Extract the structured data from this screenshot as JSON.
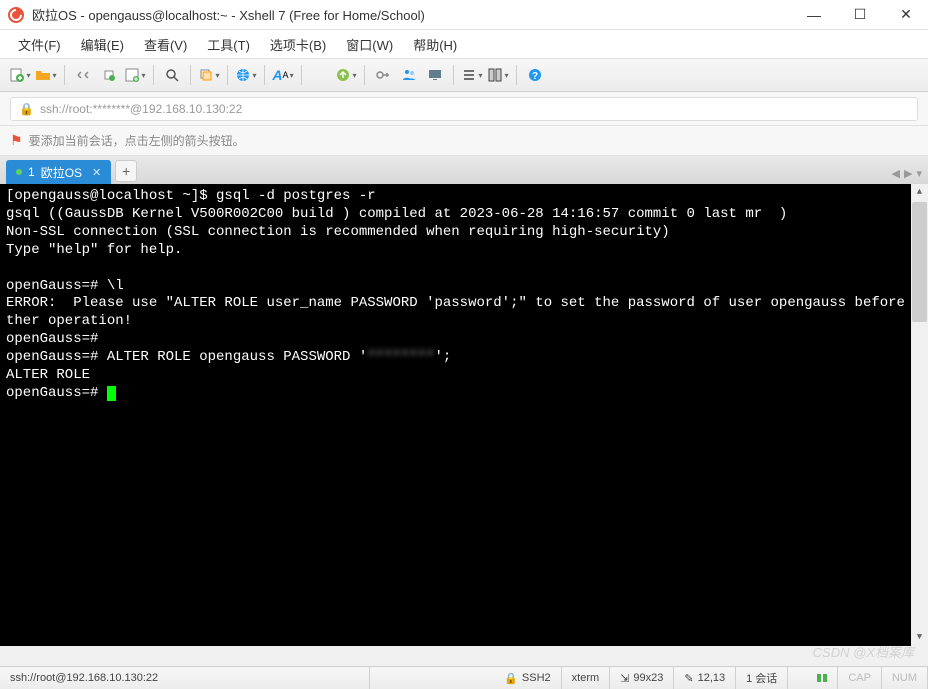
{
  "titlebar": {
    "title": "欧拉OS - opengauss@localhost:~ - Xshell 7 (Free for Home/School)"
  },
  "menu": {
    "file": "文件(F)",
    "edit": "编辑(E)",
    "view": "查看(V)",
    "tools": "工具(T)",
    "tab": "选项卡(B)",
    "window": "窗口(W)",
    "help": "帮助(H)"
  },
  "addressbar": {
    "url": "ssh://root:********@192.168.10.130:22"
  },
  "hint": {
    "text": "要添加当前会话，点击左侧的箭头按钮。"
  },
  "tabs": {
    "active": {
      "index": "1",
      "label": "欧拉OS"
    }
  },
  "terminal": {
    "lines": [
      "[opengauss@localhost ~]$ gsql -d postgres -r",
      "gsql ((GaussDB Kernel V500R002C00 build ) compiled at 2023-06-28 14:16:57 commit 0 last mr  )",
      "Non-SSL connection (SSL connection is recommended when requiring high-security)",
      "Type \"help\" for help.",
      "",
      "openGauss=# \\l",
      "ERROR:  Please use \"ALTER ROLE user_name PASSWORD 'password';\" to set the password of user opengauss before other operation!",
      "openGauss=#",
      "openGauss=# ALTER ROLE opengauss PASSWORD '********';",
      "ALTER ROLE",
      "openGauss=# "
    ],
    "masked_password": "********"
  },
  "statusbar": {
    "conn": "ssh://root@192.168.10.130:22",
    "proto": "SSH2",
    "term": "xterm",
    "size": "99x23",
    "pos": "12,13",
    "sessions": "1 会话",
    "cap": "CAP",
    "num": "NUM"
  },
  "watermark": "CSDN @X档案库",
  "icons": {
    "new": "#4caf50",
    "folder": "#f5a623",
    "cut": "#888",
    "copy": "#888",
    "paste": "#4caf50",
    "reconnect": "#4caf50",
    "find": "#555",
    "props": "#ff9800",
    "globe": "#2196f3",
    "font": "#2196f3",
    "swirl": "#e8533c",
    "gear": "#8bc34a",
    "key": "#888",
    "users": "#2196f3",
    "screen": "#607d8b",
    "list": "#444",
    "layout": "#444",
    "help": "#2196f3"
  }
}
